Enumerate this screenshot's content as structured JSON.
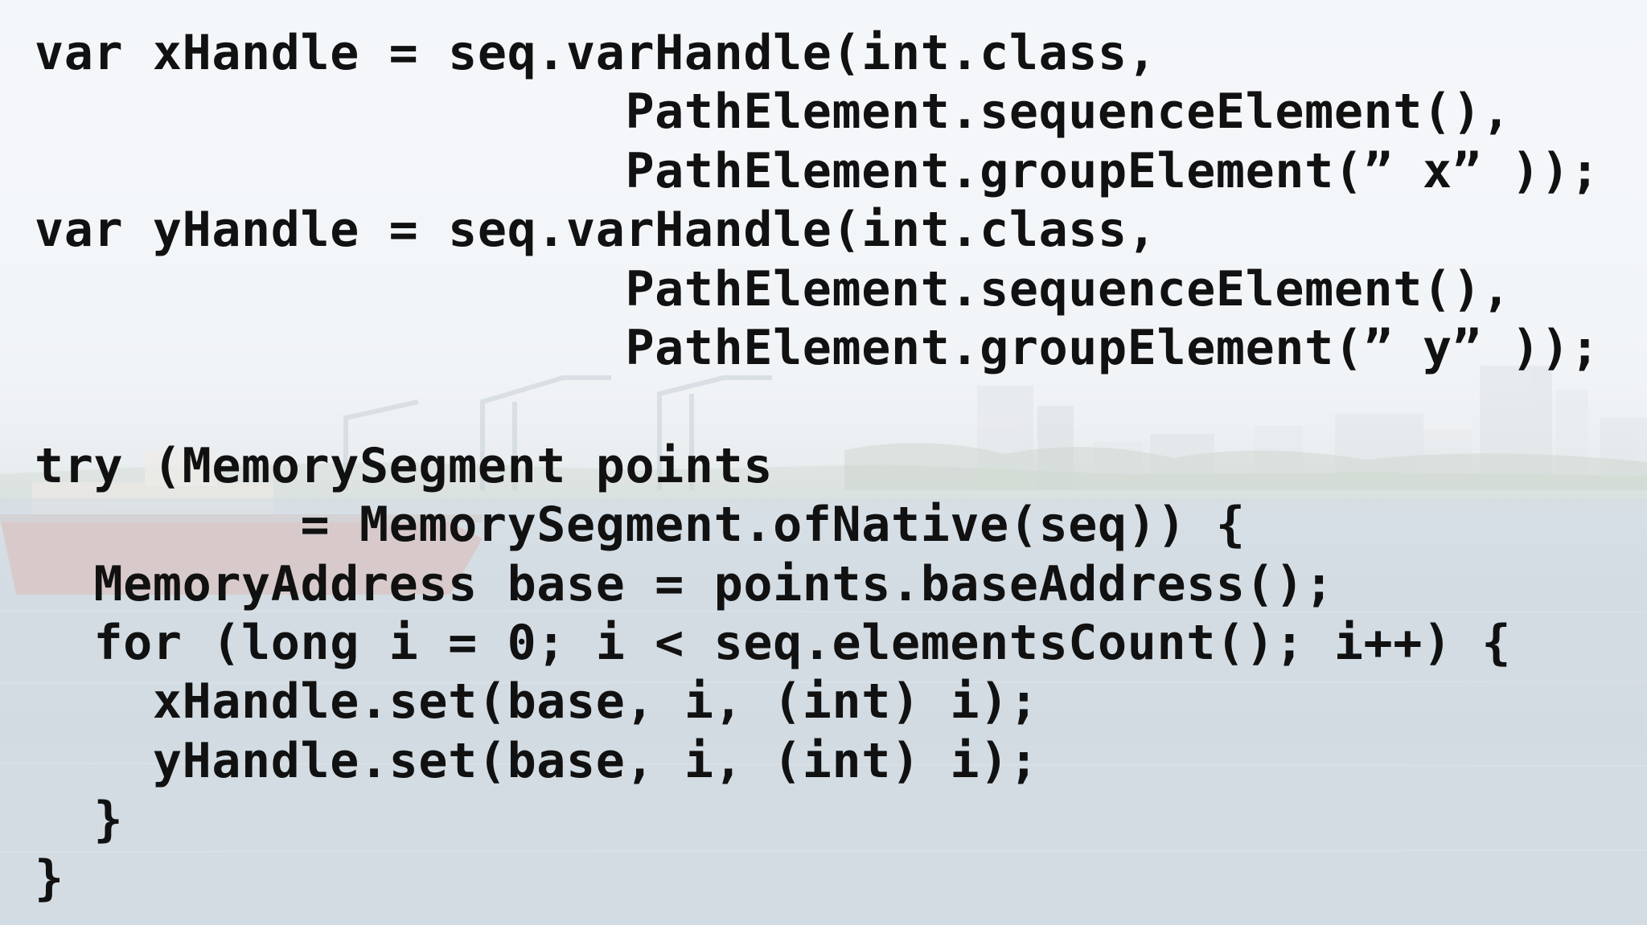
{
  "code": {
    "lines": [
      "var xHandle = seq.varHandle(int.class,",
      "                    PathElement.sequenceElement(),",
      "                    PathElement.groupElement(” x” ));",
      "var yHandle = seq.varHandle(int.class,",
      "                    PathElement.sequenceElement(),",
      "                    PathElement.groupElement(” y” ));",
      "",
      "try (MemorySegment points",
      "         = MemorySegment.ofNative(seq)) {",
      "  MemoryAddress base = points.baseAddress();",
      "  for (long i = 0; i < seq.elementsCount(); i++) {",
      "    xHandle.set(base, i, (int) i);",
      "    yHandle.set(base, i, (int) i);",
      "  }",
      "}"
    ]
  },
  "colors": {
    "code_text": "#111111",
    "sky": "#f1f4f8",
    "water": "#c3cfd8",
    "ship_hull": "#d98a7e"
  }
}
